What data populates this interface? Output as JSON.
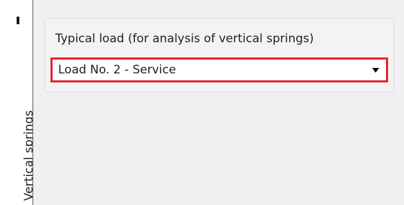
{
  "side_tab": {
    "label": "Vertical springs"
  },
  "group": {
    "label": "Typical load (for analysis of vertical springs)",
    "dropdown": {
      "selected": "Load No. 2 - Service"
    }
  },
  "icons": {
    "dropdown_arrow": "chevron-down-icon"
  },
  "colors": {
    "highlight": "#e8202a",
    "panel_background": "#f0f0f0"
  }
}
